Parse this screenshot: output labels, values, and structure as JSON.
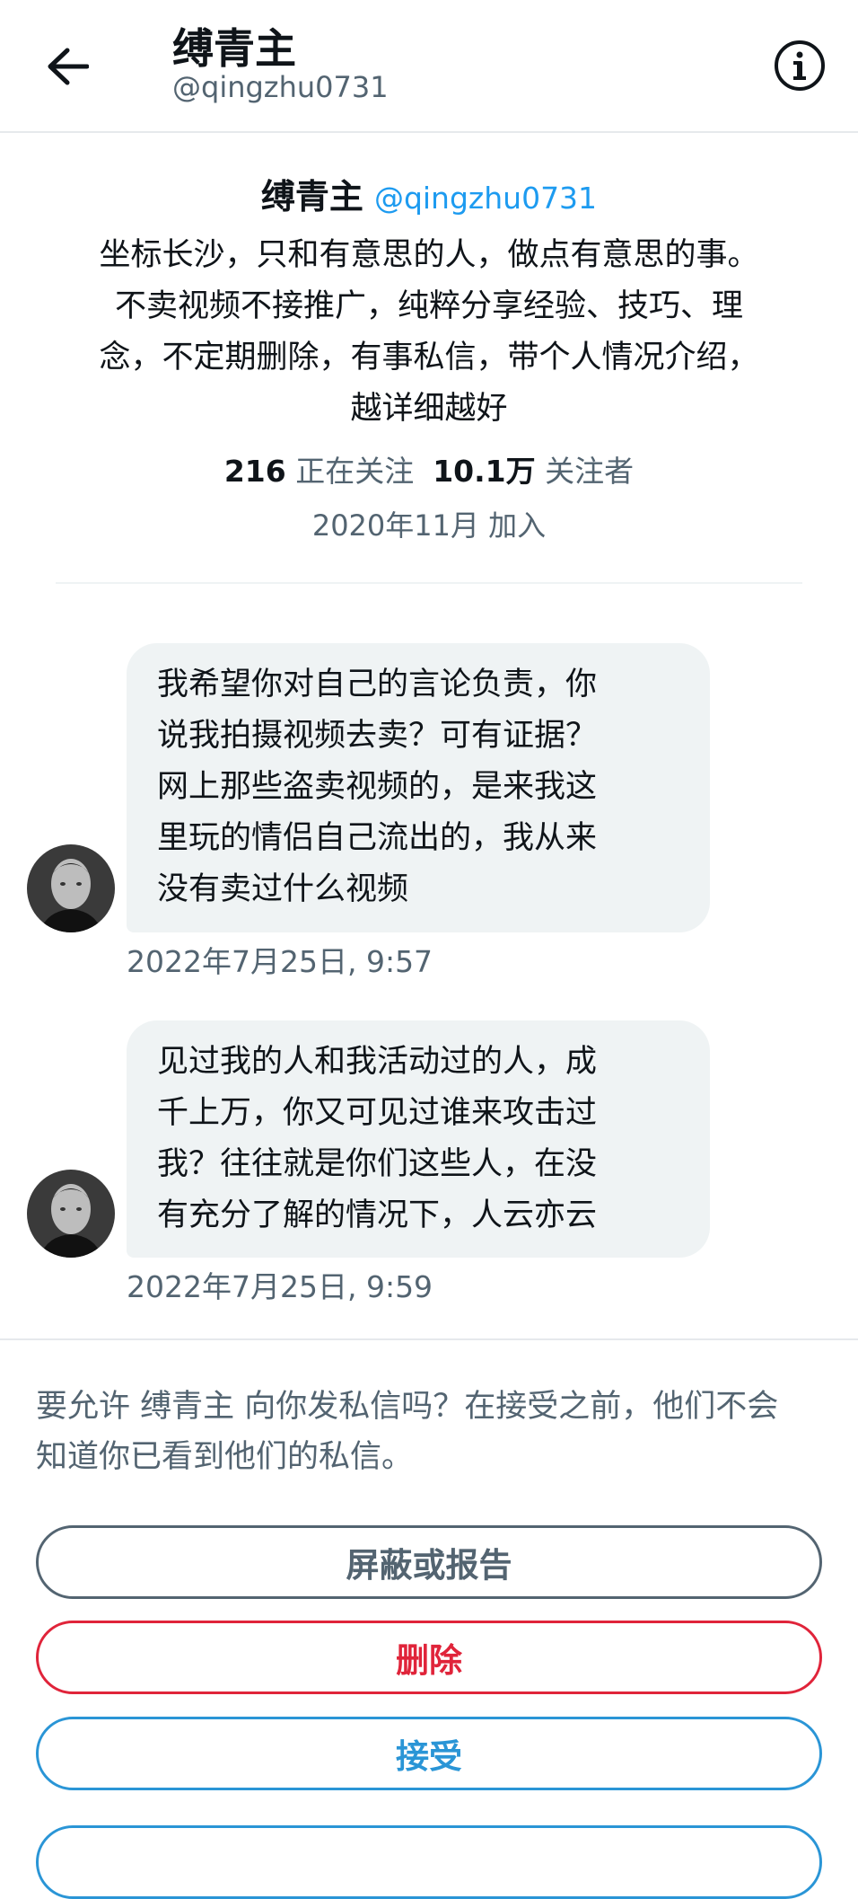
{
  "header": {
    "title": "缚青主",
    "handle": "@qingzhu0731"
  },
  "profile": {
    "name": "缚青主",
    "handle": "@qingzhu0731",
    "bio_lines": [
      "坐标长沙，只和有意思的人，做点有意思的事。",
      "不卖视频不接推广，纯粹分享经验、技巧、理",
      "念，不定期删除，有事私信，带个人情况介绍，",
      "越详细越好"
    ],
    "following_count": "216",
    "following_label": "正在关注",
    "followers_count": "10.1万",
    "followers_label": "关注者",
    "joined": "2020年11月 加入"
  },
  "messages": [
    {
      "lines": [
        "我希望你对自己的言论负责，你",
        "说我拍摄视频去卖？可有证据？",
        "网上那些盗卖视频的，是来我这",
        "里玩的情侣自己流出的，我从来",
        "没有卖过什么视频"
      ],
      "timestamp": "2022年7月25日, 9:57"
    },
    {
      "lines": [
        "见过我的人和我活动过的人，成",
        "千上万，你又可见过谁来攻击过",
        "我？往往就是你们这些人，在没",
        "有充分了解的情况下，人云亦云"
      ],
      "timestamp": "2022年7月25日, 9:59"
    }
  ],
  "request": {
    "notice_lines": [
      "要允许 缚青主 向你发私信吗？在接受之前，他们不会",
      "知道你已看到他们的私信。"
    ],
    "block_label": "屏蔽或报告",
    "delete_label": "删除",
    "accept_label": "接受"
  },
  "colors": {
    "accent": "#1d9bf0",
    "danger": "#e0243a",
    "secondary_text": "#536471",
    "bubble": "#eff3f4"
  },
  "icons": {
    "back": "arrow-left-icon",
    "info": "info-circle-icon",
    "avatar": "user-avatar"
  }
}
